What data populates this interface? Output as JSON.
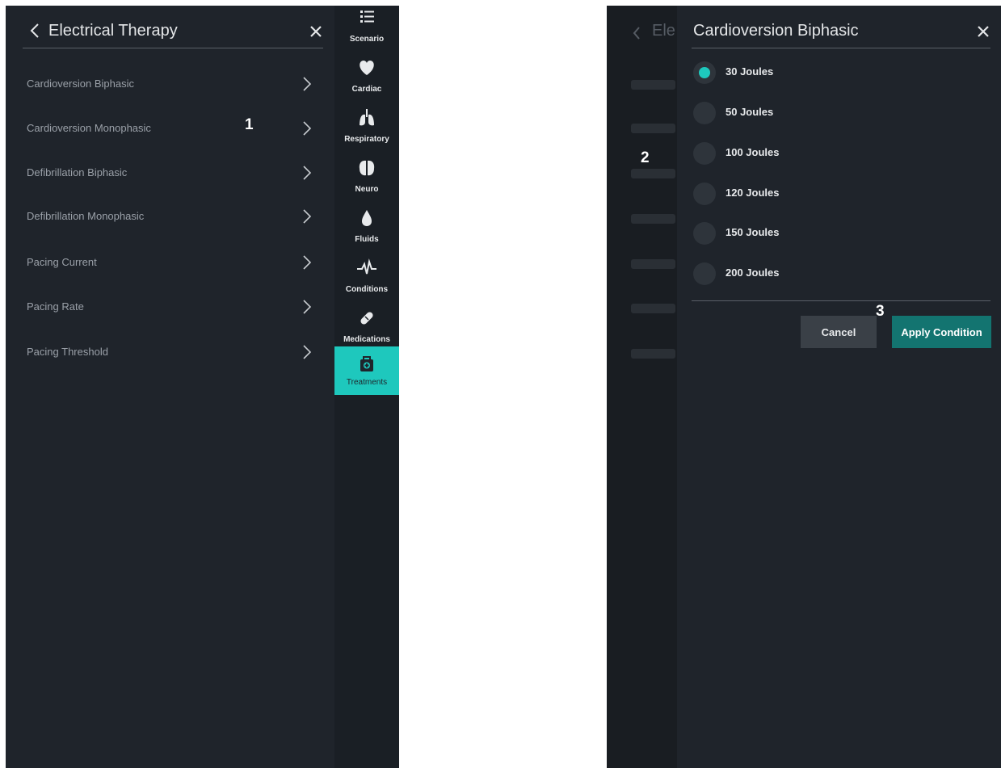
{
  "left": {
    "title": "Electrical Therapy",
    "items": [
      {
        "label": "Cardioversion Biphasic"
      },
      {
        "label": "Cardioversion Monophasic"
      },
      {
        "label": "Defibrillation Biphasic"
      },
      {
        "label": "Defibrillation Monophasic"
      },
      {
        "label": "Pacing Current"
      },
      {
        "label": "Pacing Rate"
      },
      {
        "label": "Pacing Threshold"
      }
    ]
  },
  "sidebar": {
    "items": [
      {
        "label": "Scenario",
        "icon": "list-icon"
      },
      {
        "label": "Cardiac",
        "icon": "heart-icon"
      },
      {
        "label": "Respiratory",
        "icon": "lungs-icon"
      },
      {
        "label": "Neuro",
        "icon": "brain-icon"
      },
      {
        "label": "Fluids",
        "icon": "droplet-icon"
      },
      {
        "label": "Conditions",
        "icon": "pulse-icon"
      },
      {
        "label": "Medications",
        "icon": "pill-icon"
      },
      {
        "label": "Treatments",
        "icon": "medkit-icon",
        "active": true
      }
    ]
  },
  "right": {
    "underlay_title": "Ele",
    "dialog_title": "Cardioversion Biphasic",
    "options": [
      {
        "label": "30 Joules",
        "selected": true
      },
      {
        "label": "50 Joules"
      },
      {
        "label": "100 Joules"
      },
      {
        "label": "120 Joules"
      },
      {
        "label": "150 Joules"
      },
      {
        "label": "200 Joules"
      }
    ],
    "cancel_label": "Cancel",
    "apply_label": "Apply Condition"
  },
  "annotations": {
    "one": "1",
    "two": "2",
    "three": "3"
  },
  "colors": {
    "panel_bg": "#1f242b",
    "accent": "#1ec8bd",
    "apply_button": "#137470",
    "cancel_button": "#3a4047"
  }
}
